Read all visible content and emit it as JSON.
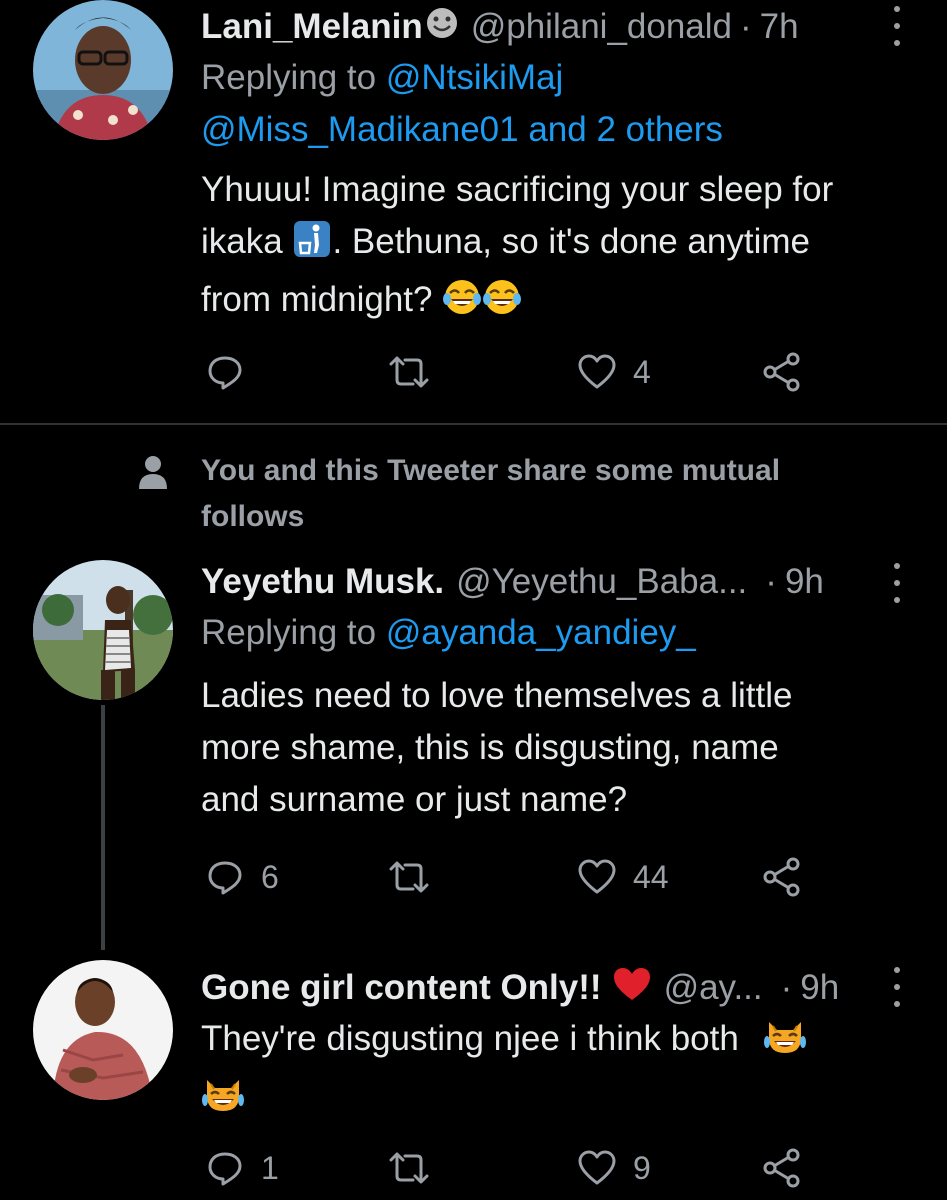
{
  "tweets": [
    {
      "name": "Lani_Melanin",
      "name_emoji": "🙂",
      "handle": "@philani_donald",
      "time": "7h",
      "replying_prefix": "Replying to ",
      "replying_to_1": "@NtsikiMaj",
      "replying_to_2": "@Miss_Madikane01 and 2 others",
      "text_1": "Yhuuu! Imagine sacrificing your sleep for",
      "text_2a": "ikaka ",
      "text_2b": ". Bethuna, so it's done anytime",
      "text_3": "from midnight? ",
      "replies": "",
      "likes": "4"
    },
    {
      "name": "Yeyethu Musk.",
      "handle": "@Yeyethu_Baba...",
      "time": "9h",
      "replying_prefix": "Replying to ",
      "replying_to_1": "@ayanda_yandiey_",
      "text_1": "Ladies need to love themselves a little",
      "text_2": "more shame, this is disgusting, name",
      "text_3": "and surname or just name?",
      "replies": "6",
      "likes": "44"
    },
    {
      "name": "Gone girl content Only!!",
      "handle": "@ay...",
      "time": "9h",
      "text_1": "They're disgusting njee i think both ",
      "replies": "1",
      "likes": "9"
    }
  ],
  "mutual_notice": "You and this Tweeter share some mutual follows",
  "separator": "·",
  "colors": {
    "background": "#000000",
    "text": "#e7e9ea",
    "secondary": "#9aa0a6",
    "link": "#1d9bf0",
    "divider": "#2f3336"
  }
}
